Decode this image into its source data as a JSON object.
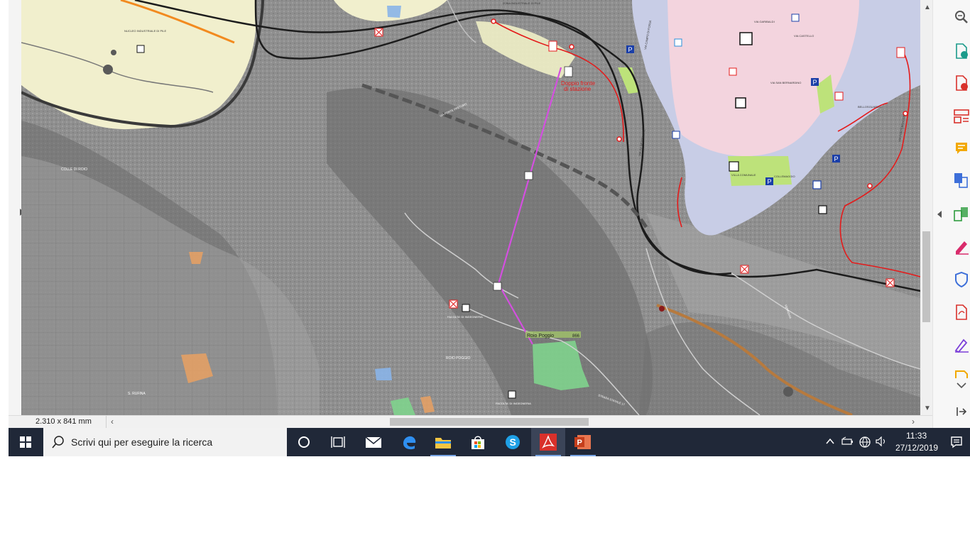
{
  "status_bar": {
    "page_size": "2.310 x 841 mm",
    "scroll_left_glyph": "‹",
    "scroll_right_glyph": "›"
  },
  "map": {
    "labels": {
      "stazione_note_line1": "Doppio fronte",
      "stazione_note_line2": "di stazione",
      "roio_poggio_station": "Roio Poggio",
      "station_elevation": "866",
      "colle_di_roio": "COLLE DI ROIO",
      "roio_poggio": "ROIO POGGIO",
      "s_rufina": "S. RUFINA",
      "nucleo_industriale": "NUCLEO INDUSTRIALE DI PILE",
      "zona_industriale": "ZONA INDUSTRIALE DI PILE",
      "facolta_ingegneria_1": "FACOLTA' DI INGEGNERIA",
      "facolta_ingegneria_2": "FACOLTA' DI INGEGNERIA",
      "via_xx_settembre": "VIA XX SETTEMBRE",
      "via_campo_di_fossa": "VIA CAMPO DI FOSSA",
      "villa_comunale": "VILLA COMUNALE",
      "via_garibaldi": "VIA GARIBALDI",
      "via_castello": "VIA CASTELLO",
      "via_san_bernardino": "VIA SAN BERNARDINO",
      "collemaggio": "COLLEMAGGIO",
      "bellosguardo": "BELLOSGUARDO",
      "via_fortebraccio": "VIA FORTEBRACCIO",
      "via_fonte_preturo": "VIA FONTE PRETURO",
      "strada_statale_17": "STRADA STATALE 17",
      "ferrovia": "FERROVIA"
    },
    "colors": {
      "urban_center": "#f3d4de",
      "suburb": "#c8cde6",
      "industrial": "#f1efcd",
      "terrain": "#8f8f8f",
      "cableway": "#d44fe0",
      "road_primary": "#1c1c1c",
      "road_red": "#e41b1b",
      "road_orange": "#f28a1f",
      "road_brown": "#b77a3e",
      "green_area": "#7fd38d",
      "orange_area": "#e9a163"
    }
  },
  "right_panel": {
    "tools": [
      {
        "name": "zoom-icon",
        "color": "#555555"
      },
      {
        "name": "export-pdf-icon",
        "color": "#1a9a8a"
      },
      {
        "name": "create-pdf-icon",
        "color": "#d9312b"
      },
      {
        "name": "organize-pages-icon",
        "color": "#d9312b"
      },
      {
        "name": "comment-icon",
        "color": "#f2a800"
      },
      {
        "name": "combine-files-icon",
        "color": "#3d6fd9"
      },
      {
        "name": "compare-icon",
        "color": "#2e9c3e"
      },
      {
        "name": "edit-pdf-icon",
        "color": "#d92b6b"
      },
      {
        "name": "protect-icon",
        "color": "#3d6fd9"
      },
      {
        "name": "pdf-export-icon",
        "color": "#d9312b"
      },
      {
        "name": "fill-sign-icon",
        "color": "#7b3fd9"
      },
      {
        "name": "stamp-icon",
        "color": "#f2a800"
      }
    ]
  },
  "taskbar": {
    "search_placeholder": "Scrivi qui per eseguire la ricerca",
    "apps": [
      {
        "name": "cortana-icon",
        "active": false
      },
      {
        "name": "task-view-icon",
        "active": false
      },
      {
        "name": "mail-icon",
        "active": false
      },
      {
        "name": "edge-icon",
        "active": false
      },
      {
        "name": "file-explorer-icon",
        "active": false
      },
      {
        "name": "store-icon",
        "active": false
      },
      {
        "name": "skype-icon",
        "active": false
      },
      {
        "name": "acrobat-icon",
        "active": true
      },
      {
        "name": "powerpoint-icon",
        "active": false
      }
    ],
    "clock": {
      "time": "11:33",
      "date": "27/12/2019"
    }
  }
}
